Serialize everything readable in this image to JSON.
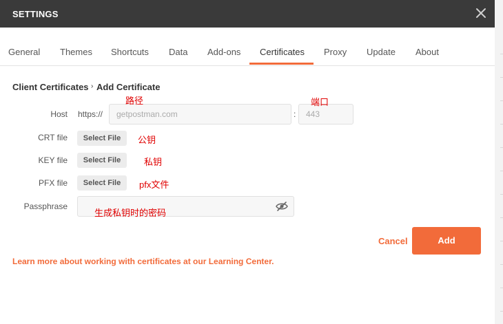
{
  "window": {
    "title": "SETTINGS"
  },
  "tabs": [
    {
      "label": "General"
    },
    {
      "label": "Themes"
    },
    {
      "label": "Shortcuts"
    },
    {
      "label": "Data"
    },
    {
      "label": "Add-ons"
    },
    {
      "label": "Certificates",
      "active": true
    },
    {
      "label": "Proxy"
    },
    {
      "label": "Update"
    },
    {
      "label": "About"
    }
  ],
  "breadcrumb": {
    "parent": "Client Certificates",
    "separator": "›",
    "current": "Add Certificate"
  },
  "form": {
    "host": {
      "label": "Host",
      "prefix": "https://",
      "placeholder": "getpostman.com",
      "port_separator": ":",
      "port_placeholder": "443"
    },
    "crt": {
      "label": "CRT file",
      "button": "Select File"
    },
    "key": {
      "label": "KEY file",
      "button": "Select File"
    },
    "pfx": {
      "label": "PFX file",
      "button": "Select File"
    },
    "passphrase": {
      "label": "Passphrase",
      "value": ""
    }
  },
  "annotations": {
    "path": "路径",
    "port": "端口",
    "public_key": "公钥",
    "private_key": "私钥",
    "pfx_file": "pfx文件",
    "passphrase_note": "生成私钥时的密码"
  },
  "actions": {
    "cancel": "Cancel",
    "add": "Add"
  },
  "footer": {
    "learn_link": "Learn more about working with certificates at our Learning Center."
  },
  "colors": {
    "accent": "#f26b3a",
    "titlebar": "#3a3a3a",
    "annotation": "#e00000"
  },
  "icons": {
    "close": "close-icon",
    "visibility": "eye-off-icon"
  }
}
